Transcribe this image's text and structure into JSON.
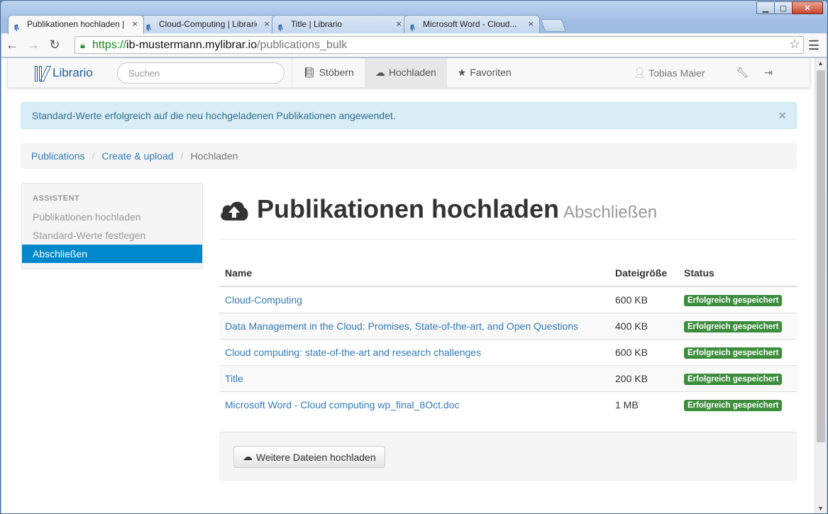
{
  "browser": {
    "tabs": [
      {
        "title": "Publikationen hochladen | Li",
        "favicon": "librario-favicon"
      },
      {
        "title": "Cloud-Computing | Librario",
        "favicon": "librario-favicon"
      },
      {
        "title": "Title | Librario",
        "favicon": "librario-favicon"
      },
      {
        "title": "Microsoft Word - Cloud...",
        "favicon": "librario-favicon"
      }
    ],
    "url": {
      "scheme": "https://",
      "host": "ib-mustermann.mylibrar.io",
      "path": "/publications_bulk"
    }
  },
  "navbar": {
    "brand": "Librario",
    "search_placeholder": "Suchen",
    "items": [
      {
        "label": "Stöbern",
        "icon": "book-icon"
      },
      {
        "label": "Hochladen",
        "icon": "cloud-upload-icon"
      },
      {
        "label": "Favoriten",
        "icon": "star-icon"
      }
    ],
    "user": "Tobias Maier"
  },
  "alert": {
    "text": "Standard-Werte erfolgreich auf die neu hochgeladenen Publikationen angewendet.",
    "close": "×"
  },
  "breadcrumb": {
    "items": [
      "Publications",
      "Create & upload"
    ],
    "current": "Hochladen"
  },
  "sidebar": {
    "heading": "ASSISTENT",
    "items": [
      "Publikationen hochladen",
      "Standard-Werte festlegen",
      "Abschließen"
    ]
  },
  "page": {
    "title": "Publikationen hochladen",
    "subtitle": "Abschließen"
  },
  "table": {
    "headers": [
      "Name",
      "Dateigröße",
      "Status"
    ],
    "rows": [
      {
        "name": "Cloud-Computing",
        "size": "600 KB",
        "status": "Erfolgreich gespeichert"
      },
      {
        "name": "Data Management in the Cloud: Promises, State-of-the-art, and Open Questions",
        "size": "400 KB",
        "status": "Erfolgreich gespeichert"
      },
      {
        "name": "Cloud computing: state-of-the-art and research challenges",
        "size": "600 KB",
        "status": "Erfolgreich gespeichert"
      },
      {
        "name": "Title",
        "size": "200 KB",
        "status": "Erfolgreich gespeichert"
      },
      {
        "name": "Microsoft Word - Cloud computing wp_final_8Oct.doc",
        "size": "1 MB",
        "status": "Erfolgreich gespeichert"
      }
    ]
  },
  "upload_more_label": "Weitere Dateien hochladen",
  "colors": {
    "primary": "#337ab7",
    "success": "#3c8d3c",
    "sidebar_active": "#0088cc",
    "alert_bg": "#d9edf7"
  }
}
